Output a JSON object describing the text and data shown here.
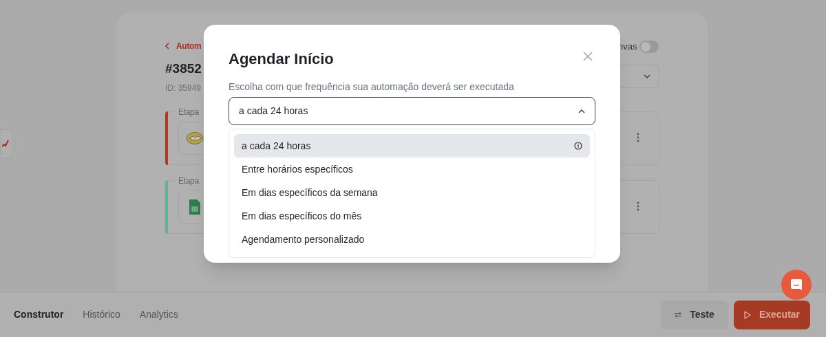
{
  "page": {
    "back_link": "Autom",
    "title": "#3852",
    "id_text": "ID: 35949",
    "canvas_label": "nvas",
    "canvas_toggle": {
      "on": false
    }
  },
  "steps": [
    {
      "label": "Etapa",
      "color": "#b0391f"
    },
    {
      "label": "Etapa",
      "color": "#5bb596"
    }
  ],
  "modal": {
    "title": "Agendar Início",
    "description": "Escolha com que frequência sua automação deverá ser executada",
    "select": {
      "value": "a cada 24 horas",
      "expanded": true
    },
    "options": [
      {
        "label": "a cada 24 horas",
        "selected": true,
        "info": true
      },
      {
        "label": "Entre horários específicos",
        "selected": false,
        "info": false
      },
      {
        "label": "Em dias específicos da semana",
        "selected": false,
        "info": false
      },
      {
        "label": "Em dias específicos do mês",
        "selected": false,
        "info": false
      },
      {
        "label": "Agendamento personalizado",
        "selected": false,
        "info": false
      }
    ]
  },
  "bottom_tabs": [
    {
      "label": "Construtor",
      "selected": true
    },
    {
      "label": "Histórico",
      "selected": false
    },
    {
      "label": "Analytics",
      "selected": false
    }
  ],
  "buttons": [
    {
      "label": "Teste",
      "kind": "secondary"
    },
    {
      "label": "Executar",
      "kind": "primary"
    }
  ]
}
